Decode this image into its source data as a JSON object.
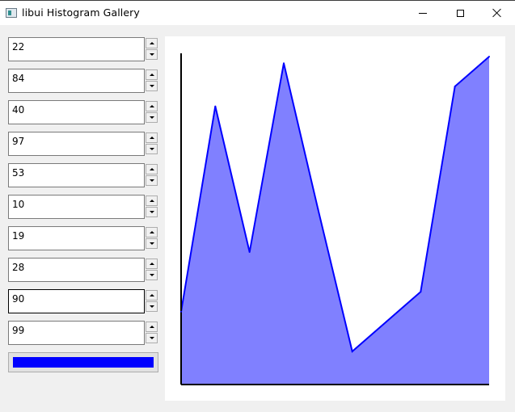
{
  "window": {
    "title": "libui Histogram Gallery",
    "icon": "app-window-icon",
    "controls": [
      "minimize-icon",
      "maximize-icon",
      "close-icon"
    ]
  },
  "spinboxes": [
    {
      "value": "22"
    },
    {
      "value": "84"
    },
    {
      "value": "40"
    },
    {
      "value": "97"
    },
    {
      "value": "53"
    },
    {
      "value": "10"
    },
    {
      "value": "19"
    },
    {
      "value": "28"
    },
    {
      "value": "90",
      "focused": true
    },
    {
      "value": "99"
    }
  ],
  "color_button": {
    "color": "#0000ff"
  },
  "chart_data": {
    "type": "area",
    "x": [
      0,
      1,
      2,
      3,
      4,
      5,
      6,
      7,
      8,
      9
    ],
    "values": [
      22,
      84,
      40,
      97,
      53,
      10,
      19,
      28,
      90,
      99
    ],
    "ylim": [
      0,
      100
    ],
    "line_color": "#0000ff",
    "fill_color": "#8080ff",
    "axis_color": "#000000",
    "grid": false
  }
}
